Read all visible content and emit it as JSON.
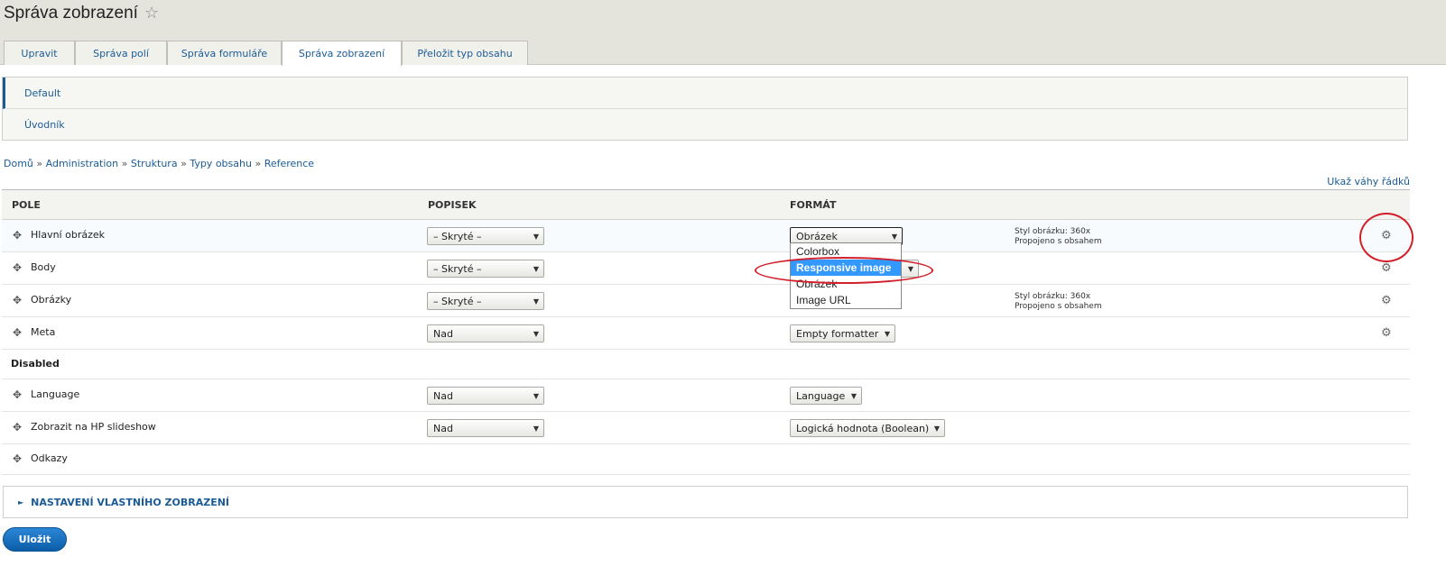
{
  "header": {
    "title": "Správa zobrazení",
    "star": "☆"
  },
  "tabs": [
    {
      "label": "Upravit"
    },
    {
      "label": "Správa polí"
    },
    {
      "label": "Správa formuláře"
    },
    {
      "label": "Správa zobrazení",
      "active": true
    },
    {
      "label": "Přeložit typ obsahu"
    }
  ],
  "subtabs": [
    {
      "label": "Default",
      "active": true
    },
    {
      "label": "Úvodník"
    }
  ],
  "breadcrumb": [
    "Domů",
    "Administration",
    "Struktura",
    "Typy obsahu",
    "Reference"
  ],
  "breadcrumb_sep": "»",
  "weights_link": "Ukaž váhy řádků",
  "table": {
    "headers": {
      "field": "POLE",
      "label": "POPISEK",
      "format": "FORMÁT"
    },
    "rows": [
      {
        "name": "Hlavní obrázek",
        "label": "– Skryté –",
        "format": "Obrázek",
        "summary": [
          "Styl obrázku: 360x",
          "Propojeno s obsahem"
        ]
      },
      {
        "name": "Body",
        "label": "– Skryté –",
        "format": ""
      },
      {
        "name": "Obrázky",
        "label": "– Skryté –",
        "format": "",
        "summary": [
          "Styl obrázku: 360x",
          "Propojeno s obsahem"
        ]
      },
      {
        "name": "Meta",
        "label": "Nad",
        "format": "Empty formatter"
      }
    ],
    "disabled_region": "Disabled",
    "disabled_rows": [
      {
        "name": "Language",
        "label": "Nad",
        "format": "Language"
      },
      {
        "name": "Zobrazit na HP slideshow",
        "label": "Nad",
        "format": "Logická hodnota (Boolean)"
      },
      {
        "name": "Odkazy"
      }
    ]
  },
  "dropdown_options": [
    {
      "label": "Colorbox"
    },
    {
      "label": "Responsive image",
      "selected": true
    },
    {
      "label": "Obrázek"
    },
    {
      "label": "Image URL"
    }
  ],
  "icons": {
    "drag": "✥",
    "gear": "⚙",
    "caret": "▼",
    "triangle": "►"
  },
  "details_label": "NASTAVENÍ VLASTNÍHO ZOBRAZENÍ",
  "save_label": "Uložit",
  "colors": {
    "link": "#1a5b96",
    "primary_button": "#0b5ea8",
    "annotation": "#d21f2a",
    "option_highlight": "#3399ff"
  }
}
